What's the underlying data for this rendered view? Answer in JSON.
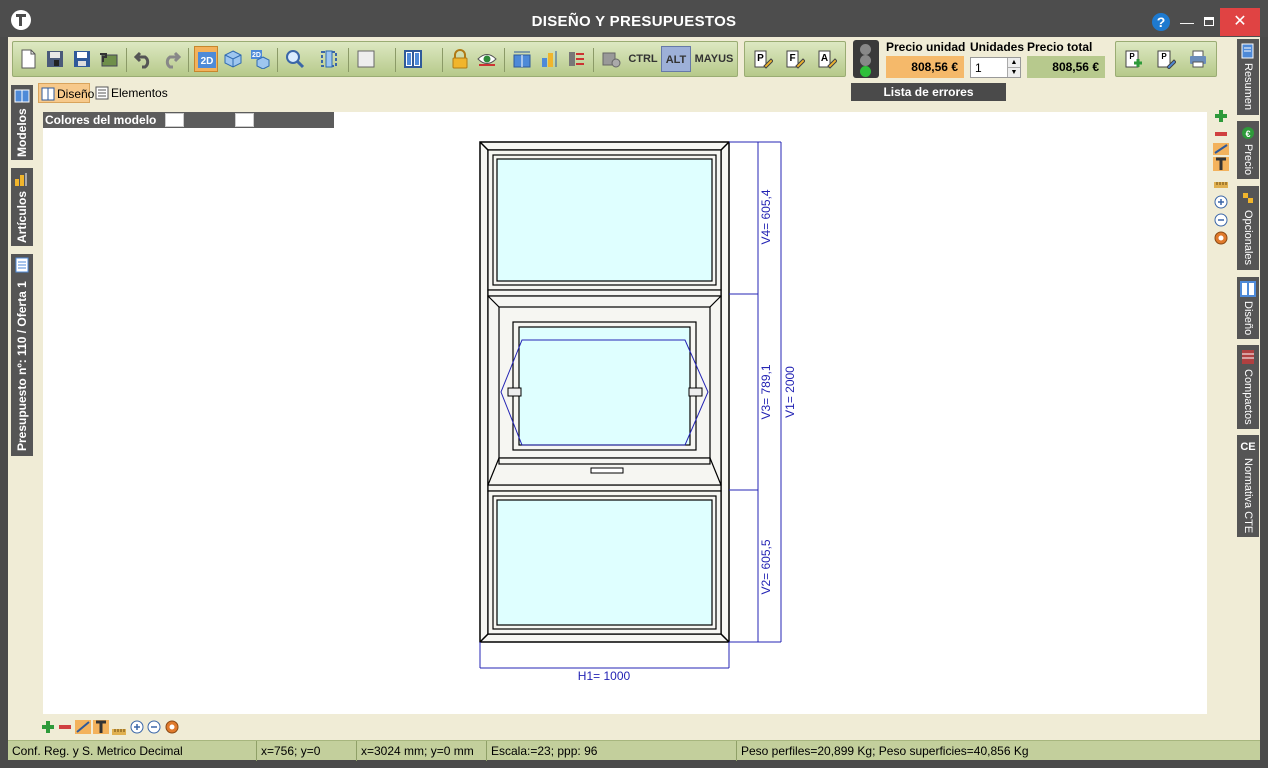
{
  "window": {
    "title": "DISEÑO Y PRESUPUESTOS",
    "help_label": "?",
    "minimize_label": "—",
    "close_label": "✕"
  },
  "toolbar": {
    "buttons": [
      "new-document",
      "save-all",
      "save",
      "open-back",
      "undo",
      "redo",
      "view-2d",
      "view-3d",
      "view-2d-3d",
      "zoom",
      "fit-view",
      "frame-shape",
      "layout",
      "lock",
      "eye-visibility",
      "dimension-horizontal",
      "dimension-vertical",
      "dimension-remove",
      "keyboard-config"
    ],
    "view_2d_label": "2D",
    "view_2d3d_label": "2D",
    "keys": {
      "ctrl": "CTRL",
      "alt": "ALT",
      "mayus": "MAYUS"
    },
    "print_group": [
      "edit-p",
      "edit-f",
      "edit-a"
    ],
    "report_group": [
      "report-new",
      "report-export",
      "print"
    ]
  },
  "pricing": {
    "unit_price_label": "Precio unidad",
    "unit_price_value": "808,56 €",
    "units_label": "Unidades",
    "units_value": "1",
    "total_price_label": "Precio total",
    "total_price_value": "808,56 €",
    "errors_button": "Lista de errores"
  },
  "left_tabs": [
    "Modelos",
    "Artículos",
    "Presupuesto nº: 110 / Oferta 1"
  ],
  "right_tabs": [
    "Resumen",
    "Precio",
    "Opcionales",
    "Diseño",
    "Compactos",
    "Normativa CTE"
  ],
  "sub_tabs": {
    "design": "Diseño",
    "elements": "Elementos"
  },
  "colors_label": "Colores del modelo",
  "drawing": {
    "dimensions": {
      "h1": "H1= 1000",
      "v1": "V1= 2000",
      "v2": "V2= 605,5",
      "v3": "V3= 789,1",
      "v4": "V4= 605,4"
    }
  },
  "status_bar": {
    "config": "Conf. Reg. y S. Metrico Decimal",
    "pixel_coords": "x=756; y=0",
    "mm_coords": "x=3024 mm; y=0 mm",
    "scale": "Escala:=23; ppp: 96",
    "weights": "Peso perfiles=20,899 Kg; Peso superficies=40,856 Kg"
  },
  "colors": {
    "glass": "#dfffff",
    "dimension": "#2424b4",
    "accent": "#f3b25c",
    "toolbar": "#c5d59c"
  }
}
